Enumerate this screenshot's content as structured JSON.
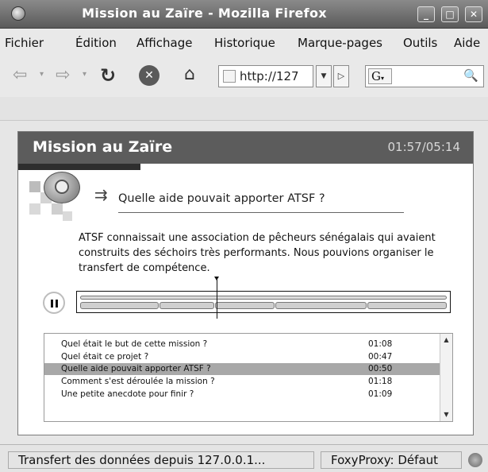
{
  "window": {
    "title": "Mission au Zaïre - Mozilla Firefox"
  },
  "menu": [
    "Fichier",
    "Édition",
    "Affichage",
    "Historique",
    "Marque-pages",
    "Outils",
    "Aide"
  ],
  "toolbar": {
    "url": "http://127",
    "search_engine": "G"
  },
  "page": {
    "title": "Mission au Zaïre",
    "time": "01:57/05:14",
    "question": "Quelle aide pouvait apporter ATSF ?",
    "answer": "ATSF connaissait une association de pêcheurs sénégalais qui avaient construits des séchoirs très performants. Nous pouvions organiser le transfert de compétence.",
    "chapters": [
      {
        "label": "Quel était le but de cette mission ?",
        "duration": "01:08",
        "selected": false
      },
      {
        "label": "Quel était ce projet ?",
        "duration": "00:47",
        "selected": false
      },
      {
        "label": "Quelle aide pouvait apporter ATSF ?",
        "duration": "00:50",
        "selected": true
      },
      {
        "label": "Comment s'est déroulée la mission ?",
        "duration": "01:18",
        "selected": false
      },
      {
        "label": "Une petite anecdote pour finir ?",
        "duration": "01:09",
        "selected": false
      }
    ]
  },
  "status": {
    "text": "Transfert des données depuis 127.0.0.1...",
    "proxy": "FoxyProxy: Défaut"
  }
}
